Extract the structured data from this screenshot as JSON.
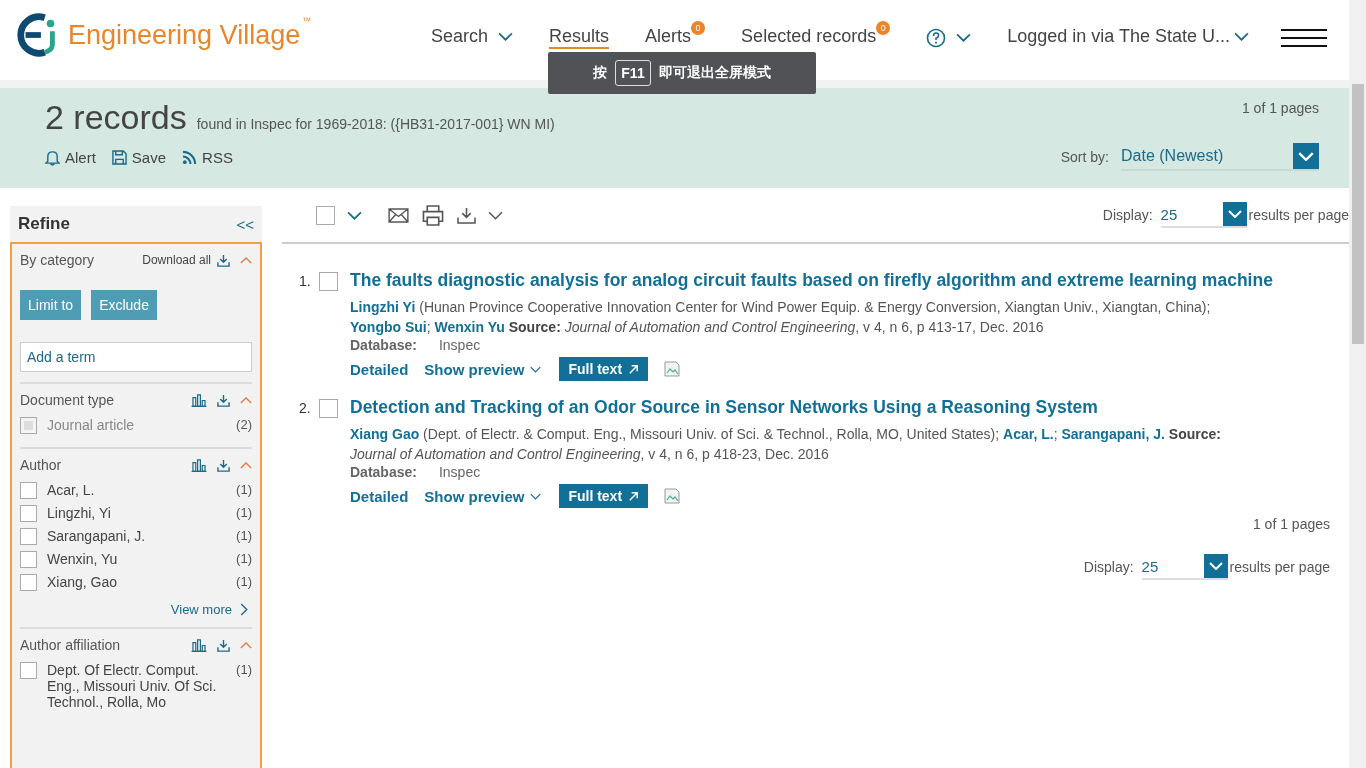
{
  "header": {
    "logo": "Engineering Village",
    "trademark": "™",
    "nav": [
      {
        "label": "Search",
        "kind": "dropdown",
        "selected": false
      },
      {
        "label": "Results",
        "kind": "link",
        "selected": true
      },
      {
        "label": "Alerts",
        "kind": "badge",
        "badge": "0",
        "selected": false
      },
      {
        "label": "Selected records",
        "kind": "badge",
        "badge": "0",
        "selected": false
      }
    ],
    "login": "Logged in via The State U..."
  },
  "toast": {
    "prefix": "按",
    "key": "F11",
    "text": "即可退出全屏模式"
  },
  "summary": {
    "count": "2 records",
    "query": "found in Inspec for 1969-2018: ({HB31-2017-001} WN MI)",
    "actions": [
      {
        "label": "Alert",
        "kind": "bell"
      },
      {
        "label": "Save",
        "kind": "save"
      },
      {
        "label": "RSS",
        "kind": "rss"
      }
    ],
    "pages": "1 of 1 pages",
    "sort_label": "Sort by:",
    "sort_value": "Date (Newest)"
  },
  "refine": {
    "title": "Refine",
    "collapse": "<<",
    "category": "By category",
    "download_all": "Download all",
    "buttons": [
      "Limit to",
      "Exclude"
    ],
    "placeholder": "Add a term",
    "facets": [
      {
        "title": "Document type",
        "items": [
          {
            "label": "Journal article",
            "count": "(2)",
            "checked": false,
            "disabled": true
          }
        ]
      },
      {
        "title": "Author",
        "items": [
          {
            "label": "Acar, L.",
            "count": "(1)",
            "checked": false,
            "disabled": false
          },
          {
            "label": "Lingzhi, Yi",
            "count": "(1)",
            "checked": false,
            "disabled": false
          },
          {
            "label": "Sarangapani, J.",
            "count": "(1)",
            "checked": false,
            "disabled": false
          },
          {
            "label": "Wenxin, Yu",
            "count": "(1)",
            "checked": false,
            "disabled": false
          },
          {
            "label": "Xiang, Gao",
            "count": "(1)",
            "checked": false,
            "disabled": false
          }
        ],
        "view_more": "View more"
      },
      {
        "title": "Author affiliation",
        "items": [
          {
            "label": "Dept. Of Electr. Comput. Eng., Missouri Univ. Of Sci. Technol., Rolla, Mo",
            "count": "(1)",
            "checked": false,
            "disabled": false
          }
        ]
      }
    ]
  },
  "select_all": {
    "checked": false
  },
  "display": {
    "label": "Display:",
    "value": "25",
    "suffix": "results per page"
  },
  "records": [
    {
      "number": "1.",
      "checked": false,
      "title": "The faults diagnostic analysis for analog circuit faults based on firefly algorithm and extreme learning machine",
      "segments": [
        {
          "kind": "author",
          "text": "Lingzhi Yi"
        },
        {
          "kind": "text",
          "text": " (Hunan Province Cooperative Innovation Center for Wind Power Equip. & Energy Conversion, Xiangtan Univ., Xiangtan, China);"
        },
        {
          "kind": "break"
        },
        {
          "kind": "author",
          "text": "Yongbo Sui"
        },
        {
          "kind": "text",
          "text": "; "
        },
        {
          "kind": "author",
          "text": "Wenxin Yu"
        },
        {
          "kind": "label",
          "text": " Source: "
        },
        {
          "kind": "journal",
          "text": "Journal of Automation and Control Engineering"
        },
        {
          "kind": "text",
          "text": ", v 4, n 6, p 413-17, Dec. 2016"
        }
      ],
      "database_label": "Database:",
      "database": "Inspec",
      "detailed": "Detailed",
      "preview": "Show preview",
      "fulltext": "Full text"
    },
    {
      "number": "2.",
      "checked": false,
      "title": "Detection and Tracking of an Odor Source in Sensor Networks Using a Reasoning System",
      "segments": [
        {
          "kind": "author",
          "text": "Xiang Gao"
        },
        {
          "kind": "text",
          "text": " (Dept. of Electr. & Comput. Eng., Missouri Univ. of Sci. & Technol., Rolla, MO, United States); "
        },
        {
          "kind": "author",
          "text": "Acar, L."
        },
        {
          "kind": "text",
          "text": "; "
        },
        {
          "kind": "author",
          "text": "Sarangapani, J."
        },
        {
          "kind": "label",
          "text": " Source:"
        },
        {
          "kind": "break"
        },
        {
          "kind": "journal",
          "text": "Journal of Automation and Control Engineering"
        },
        {
          "kind": "text",
          "text": ", v 4, n 6, p 418-23, Dec. 2016"
        }
      ],
      "database_label": "Database:",
      "database": "Inspec",
      "detailed": "Detailed",
      "preview": "Show preview",
      "fulltext": "Full text"
    }
  ],
  "footer": {
    "pages": "1 of 1 pages",
    "display_label": "Display:",
    "display_value": "25",
    "display_suffix": "results per page"
  }
}
